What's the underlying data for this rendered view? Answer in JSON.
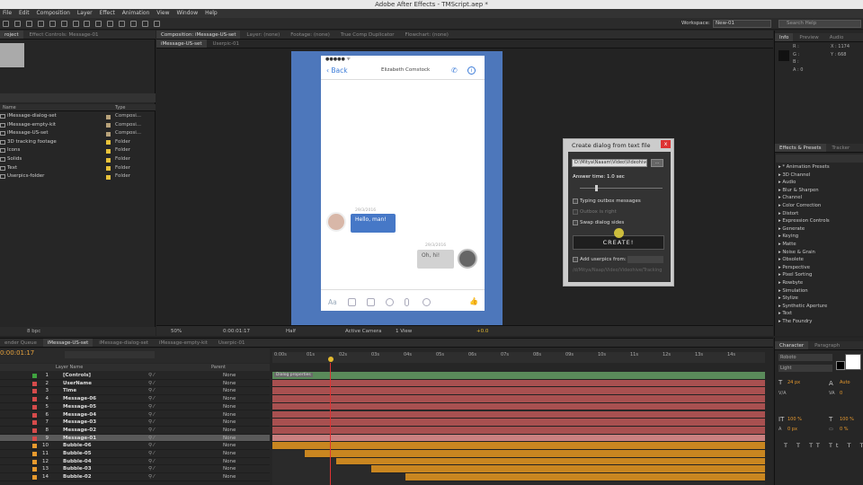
{
  "window": {
    "title": "Adobe After Effects - TMScript.aep *"
  },
  "menu": [
    "File",
    "Edit",
    "Composition",
    "Layer",
    "Effect",
    "Animation",
    "View",
    "Window",
    "Help"
  ],
  "workspace": {
    "label": "Workspace:",
    "value": "New-01",
    "search_placeholder": "Search Help"
  },
  "project": {
    "tabs": [
      "roject",
      "Effect Controls: Message-01"
    ],
    "col_name": "Name",
    "col_type": "Type",
    "items": [
      {
        "name": "iMessage-dialog-set",
        "type": "Composi...",
        "color": "#b8a27a"
      },
      {
        "name": "iMessage-empty-kit",
        "type": "Composi...",
        "color": "#b8a27a"
      },
      {
        "name": "iMessage-US-set",
        "type": "Composi...",
        "color": "#b8a27a"
      },
      {
        "name": "3D tracking footage",
        "type": "Folder",
        "color": "#e8c23a"
      },
      {
        "name": "Icons",
        "type": "Folder",
        "color": "#e8c23a"
      },
      {
        "name": "Solids",
        "type": "Folder",
        "color": "#e8c23a"
      },
      {
        "name": "Text",
        "type": "Folder",
        "color": "#e8c23a"
      },
      {
        "name": "Userpics-folder",
        "type": "Folder",
        "color": "#e8c23a"
      }
    ],
    "footer": "8 bpc"
  },
  "comp": {
    "tabs": [
      "Composition: iMessage-US-set",
      "Layer: (none)",
      "Footage: (none)",
      "True Comp Duplicator",
      "Flowchart: (none)"
    ],
    "subtabs": [
      "iMessage-US-set",
      "Userpic-01"
    ],
    "footer": {
      "zoom": "50%",
      "timecode": "0:00:01:17",
      "resolution": "Half",
      "camera": "Active Camera",
      "views": "1 View",
      "exposure": "+0.0"
    }
  },
  "phone": {
    "status": "●●●●● ᯤ",
    "back": "Back",
    "contact": "Elizabeth Comstock",
    "msg1": {
      "date": "29/3/2016",
      "text": "Hello, man!"
    },
    "msg2": {
      "date": "29/3/2016",
      "text": "Oh, hi!"
    },
    "input_label": "Aa"
  },
  "dialog": {
    "title": "Create dialog from text file",
    "close": "x",
    "path": "D:\\Mitya\\Naaam\\Video\\Videohive\\",
    "browse": "...",
    "answer_time": "Answer time: 1.0 sec",
    "typing": "Typing outbox messages",
    "outbox_right": "Outbox is right",
    "swap": "Swap dialog sides",
    "create": "CREATE!",
    "add_userpics": "Add userpics from:",
    "userpics_path": "/d/Mitya/Naap/Video/Videohive/Tracking"
  },
  "info": {
    "tabs": [
      "Info",
      "Preview",
      "Audio"
    ],
    "r": "R :",
    "g": "G :",
    "b": "B :",
    "a": "A : 0",
    "x": "X : 1174",
    "y": "Y : 668"
  },
  "effects": {
    "tabs": [
      "Effects & Presets",
      "Tracker"
    ],
    "items": [
      "* Animation Presets",
      "3D Channel",
      "Audio",
      "Blur & Sharpen",
      "Channel",
      "Color Correction",
      "Distort",
      "Expression Controls",
      "Generate",
      "Keying",
      "Matte",
      "Noise & Grain",
      "Obsolete",
      "Perspective",
      "Pixel Sorting",
      "Rowbyte",
      "Simulation",
      "Stylize",
      "Synthetic Aperture",
      "Text",
      "The Foundry"
    ]
  },
  "timeline": {
    "tabs": [
      "ender Queue",
      "iMessage-US-set",
      "iMessage-dialog-set",
      "iMessage-empty-kit",
      "Userpic-01"
    ],
    "timecode": "0:00:01:17",
    "col_layer": "Layer Name",
    "col_parent": "Parent",
    "ruler": [
      "0:00s",
      "01s",
      "02s",
      "03s",
      "04s",
      "05s",
      "06s",
      "07s",
      "08s",
      "09s",
      "10s",
      "11s",
      "12s",
      "13s",
      "14s"
    ],
    "marker": "Dialog properties",
    "layers": [
      {
        "num": "1",
        "name": "[Controls]",
        "parent": "None",
        "color": "#3fa33f",
        "start": 0,
        "end": 1
      },
      {
        "num": "2",
        "name": "UserName",
        "parent": "None",
        "color": "#d64b4b",
        "start": 0,
        "end": 1
      },
      {
        "num": "3",
        "name": "Time",
        "parent": "None",
        "color": "#d64b4b",
        "start": 0,
        "end": 1
      },
      {
        "num": "4",
        "name": "Message-06",
        "parent": "None",
        "color": "#d64b4b",
        "start": 0,
        "end": 1
      },
      {
        "num": "5",
        "name": "Message-05",
        "parent": "None",
        "color": "#d64b4b",
        "start": 0,
        "end": 1
      },
      {
        "num": "6",
        "name": "Message-04",
        "parent": "None",
        "color": "#d64b4b",
        "start": 0,
        "end": 1
      },
      {
        "num": "7",
        "name": "Message-03",
        "parent": "None",
        "color": "#d64b4b",
        "start": 0,
        "end": 1
      },
      {
        "num": "8",
        "name": "Message-02",
        "parent": "None",
        "color": "#d64b4b",
        "start": 0,
        "end": 1
      },
      {
        "num": "9",
        "name": "Message-01",
        "parent": "None",
        "color": "#d64b4b",
        "start": 0,
        "end": 1,
        "selected": true
      },
      {
        "num": "10",
        "name": "Bubble-06",
        "parent": "None",
        "color": "#e89a2e",
        "start": 0,
        "end": 1
      },
      {
        "num": "11",
        "name": "Bubble-05",
        "parent": "None",
        "color": "#e89a2e",
        "start": 0.065,
        "end": 1
      },
      {
        "num": "12",
        "name": "Bubble-04",
        "parent": "None",
        "color": "#e89a2e",
        "start": 0.13,
        "end": 1
      },
      {
        "num": "13",
        "name": "Bubble-03",
        "parent": "None",
        "color": "#e89a2e",
        "start": 0.2,
        "end": 1
      },
      {
        "num": "14",
        "name": "Bubble-02",
        "parent": "None",
        "color": "#e89a2e",
        "start": 0.27,
        "end": 1
      }
    ]
  },
  "character": {
    "tabs": [
      "Character",
      "Paragraph"
    ],
    "font": "Roboto",
    "style": "Light",
    "size": "24 px",
    "leading": "Auto",
    "tracking": "0",
    "scale_v": "100 %",
    "scale_h": "100 %",
    "baseline": "0 px",
    "tsume": "0 %"
  }
}
